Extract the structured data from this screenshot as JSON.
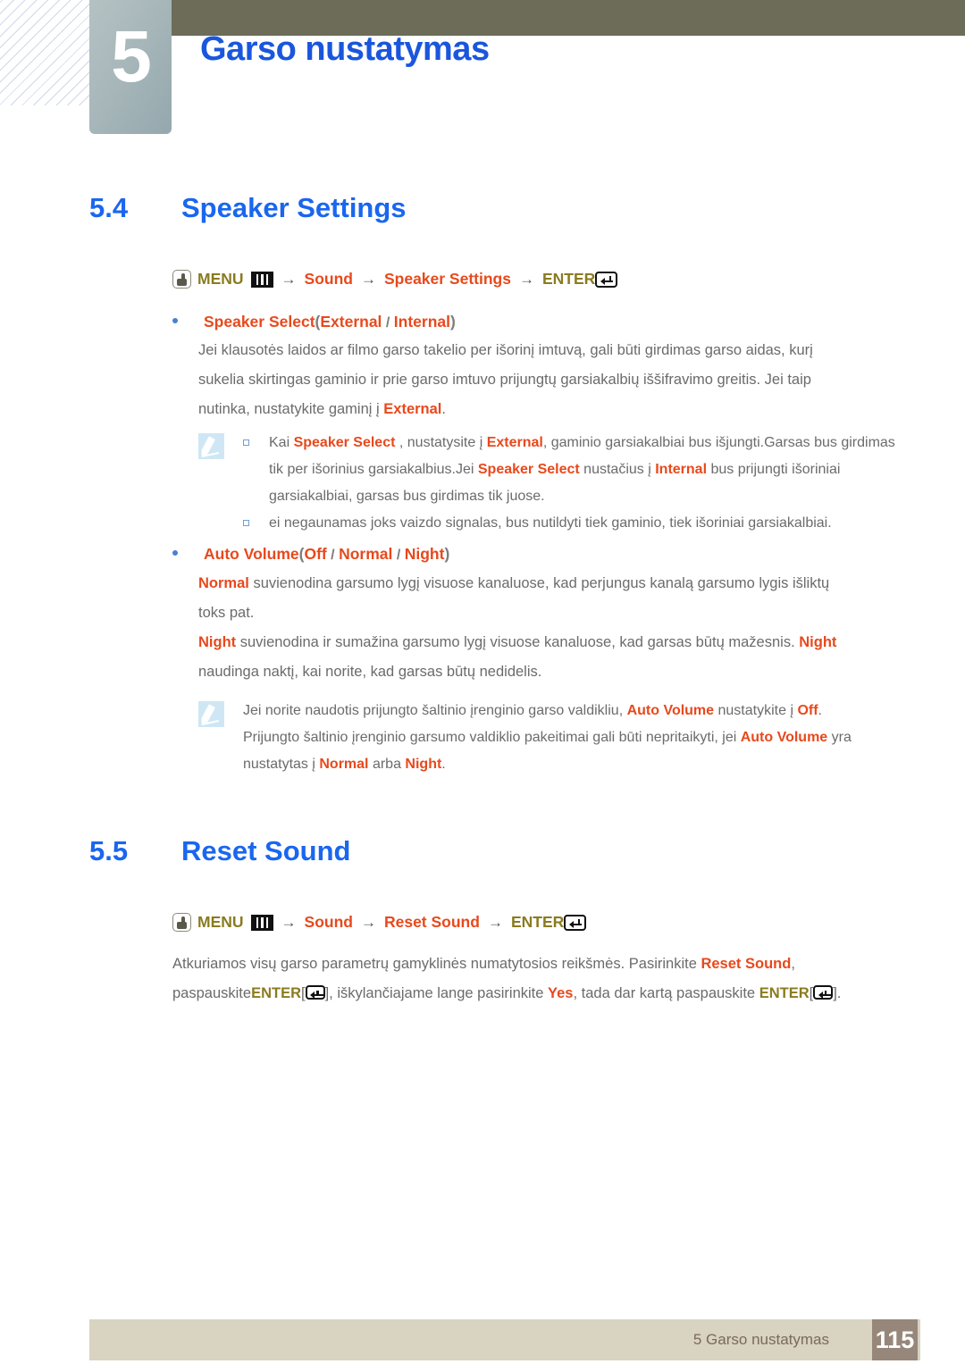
{
  "chapter": {
    "number": "5",
    "title": "Garso nustatymas"
  },
  "sections": [
    {
      "number": "5.4",
      "title": "Speaker Settings"
    },
    {
      "number": "5.5",
      "title": "Reset Sound"
    }
  ],
  "nav_speaker": {
    "hand_icon": "hand-press-icon",
    "menu_label": "MENU",
    "bars_icon": "menu-bars-icon",
    "arrow": "→",
    "item1": "Sound",
    "item2": "Speaker Settings",
    "enter_label": "ENTER",
    "enter_icon": "enter-key-icon"
  },
  "nav_reset": {
    "hand_icon": "hand-press-icon",
    "menu_label": "MENU",
    "bars_icon": "menu-bars-icon",
    "arrow": "→",
    "item1": "Sound",
    "item2": "Reset Sound",
    "enter_label": "ENTER",
    "enter_icon": "enter-key-icon"
  },
  "speaker_select": {
    "label": "Speaker Select",
    "open_paren": "(",
    "opt1": "External",
    "sep": " / ",
    "opt2": "Internal",
    "close_paren": ")",
    "paragraph_l1": "Jei klausotės laidos ar filmo garso takelio per išorinį imtuvą, gali būti girdimas garso aidas, kurį",
    "paragraph_l2": "sukelia skirtingas gaminio ir prie garso imtuvo prijungtų garsiakalbių iššifravimo greitis. Jei taip",
    "paragraph_l3a": "nutinka, nustatykite gaminį į ",
    "paragraph_l3_hl": "External",
    "paragraph_l3b": "."
  },
  "note1": {
    "icon": "note-pencil-icon",
    "item1": {
      "t1": "Kai ",
      "h1": "Speaker Select",
      "t2": " , nustatysite į ",
      "h2": "External",
      "t3": ", gaminio garsiakalbiai bus išjungti.Garsas bus girdimas tik per išorinius garsiakalbius.Jei ",
      "h3": "Speaker Select",
      "t4": " nustačius į ",
      "h4": "Internal",
      "t5": " bus prijungti išoriniai garsiakalbiai, garsas bus girdimas tik juose."
    },
    "item2": {
      "t1": "ei negaunamas joks vaizdo signalas, bus nutildyti tiek gaminio, tiek išoriniai garsiakalbiai."
    }
  },
  "auto_volume": {
    "label": "Auto Volume",
    "open_paren": "(",
    "opt1": "Off",
    "sep1": " / ",
    "opt2": "Normal",
    "sep2": " / ",
    "opt3": "Night",
    "close_paren": ")",
    "p1_hl": "Normal",
    "p1_l1": " suvienodina garsumo lygį visuose kanaluose, kad perjungus kanalą garsumo lygis išliktų",
    "p1_l2": "toks pat.",
    "p2_hl": "Night",
    "p2_l1a": " suvienodina ir sumažina garsumo lygį visuose kanaluose, kad garsas būtų mažesnis. ",
    "p2_l1_hl2": "Night",
    "p2_l2": "naudinga naktį, kai norite, kad garsas būtų nedidelis."
  },
  "note2": {
    "icon": "note-pencil-icon",
    "t1": "Jei norite naudotis prijungto šaltinio įrenginio garso valdikliu, ",
    "h1": "Auto Volume",
    "t2": " nustatykite į ",
    "h2": "Off",
    "t3": ". Prijungto šaltinio įrenginio garsumo valdiklio pakeitimai gali būti nepritaikyti, jei ",
    "h3": "Auto Volume",
    "t4": " yra nustatytas į ",
    "h4": "Normal",
    "t5": " arba ",
    "h5": "Night",
    "t6": "."
  },
  "reset_sound": {
    "p_l1a": "Atkuriamos visų garso parametrų gamyklinės numatytosios reikšmės. Pasirinkite ",
    "p_l1_hl": "Reset Sound",
    "p_l1b": ",",
    "p_l2a": "paspauskite",
    "p_l2_enter1": "ENTER",
    "p_l2b": "[",
    "p_l2c": "], iškylančiajame lange pasirinkite ",
    "p_l2_hl": "Yes",
    "p_l2d": ", tada dar kartą paspauskite ",
    "p_l2_enter2": "ENTER",
    "p_l2e": "[",
    "p_l2f": "]."
  },
  "footer": {
    "text": "5 Garso nustatymas",
    "page": "115"
  },
  "colors": {
    "banner": "#6d6c58",
    "chapter_title": "#1a56dd",
    "section_heading": "#1a66ef",
    "highlight": "#e8491c",
    "olive": "#8a7b1f",
    "body_text": "#6b6b6b",
    "footer_bar": "#d9d3c1",
    "footer_page": "#97877a"
  }
}
